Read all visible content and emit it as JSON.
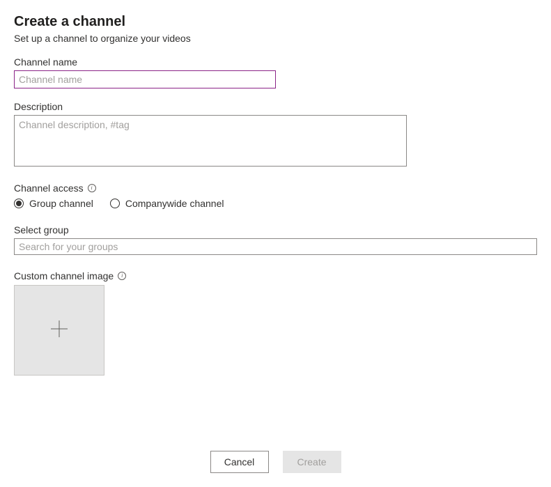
{
  "header": {
    "title": "Create a channel",
    "subtitle": "Set up a channel to organize your videos"
  },
  "channelName": {
    "label": "Channel name",
    "placeholder": "Channel name",
    "value": ""
  },
  "description": {
    "label": "Description",
    "placeholder": "Channel description, #tag",
    "value": ""
  },
  "channelAccess": {
    "label": "Channel access",
    "options": {
      "group": "Group channel",
      "companywide": "Companywide channel"
    },
    "selected": "group"
  },
  "selectGroup": {
    "label": "Select group",
    "placeholder": "Search for your groups",
    "value": ""
  },
  "customImage": {
    "label": "Custom channel image"
  },
  "buttons": {
    "cancel": "Cancel",
    "create": "Create"
  }
}
